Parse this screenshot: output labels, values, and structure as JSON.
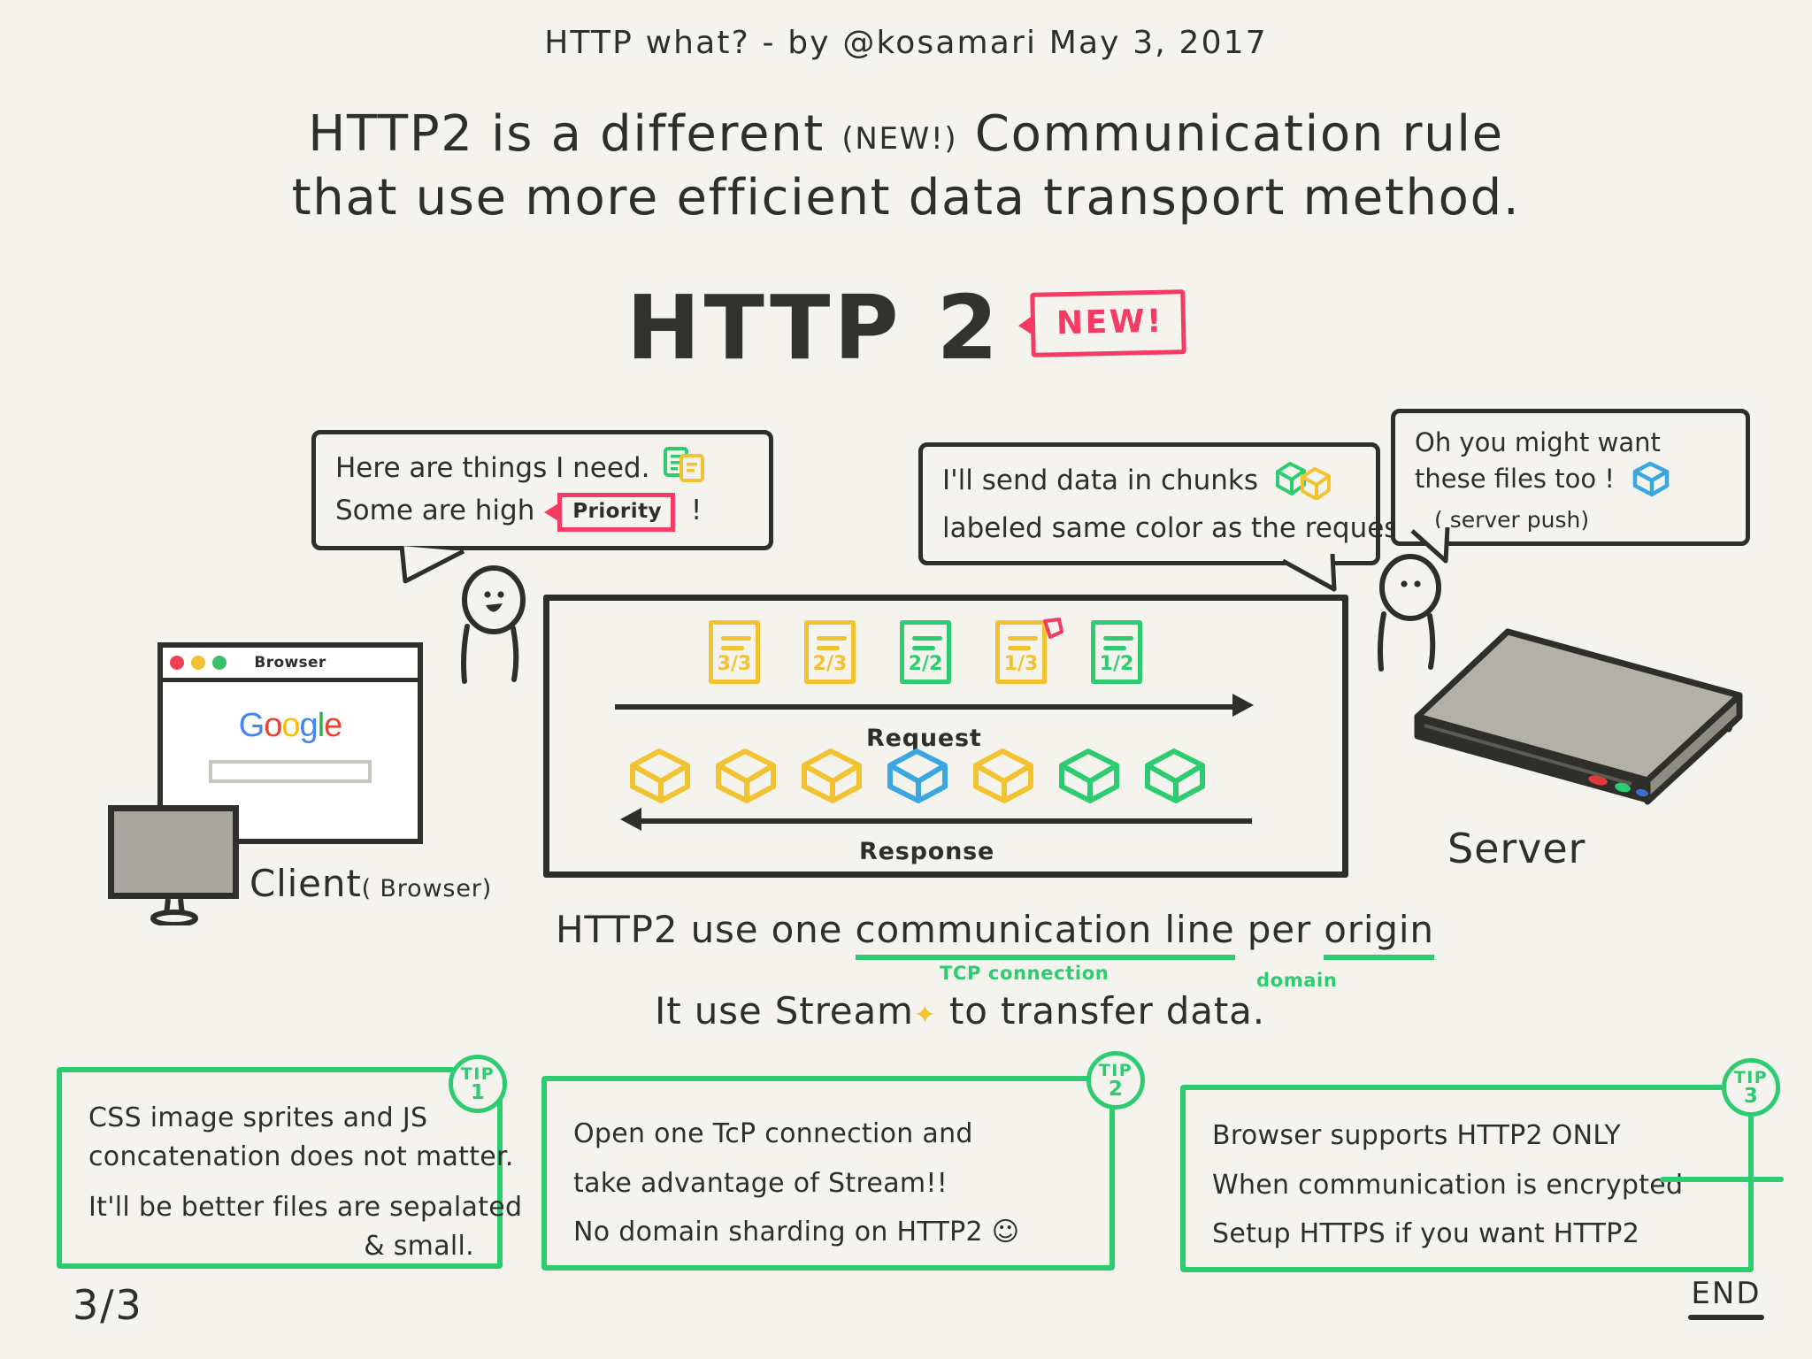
{
  "header": {
    "byline": "HTTP what? - by @kosamari   May 3, 2017",
    "headline_line1_a": "HTTP2 is a different",
    "headline_new": "(NEW!)",
    "headline_line1_b": "Communication rule",
    "headline_line2": "that use  more efficient data transport method.",
    "big_title": "HTTP 2",
    "new_badge": "NEW!"
  },
  "bubbles": {
    "client": {
      "line1": "Here are things I need.",
      "line2_before": "Some are high",
      "priority_tag": "Priority",
      "line2_after": "!"
    },
    "server_chunks": {
      "line1": "I'll send data in chunks",
      "line2": "labeled same color as the request."
    },
    "server_push": {
      "line1": "Oh you might want",
      "line2": "these files too !",
      "line3": "( server push)"
    }
  },
  "client": {
    "browser_title": "Browser",
    "logo": "Google",
    "logo_letters": [
      {
        "char": "G",
        "color": "#4285f4"
      },
      {
        "char": "o",
        "color": "#ea4335"
      },
      {
        "char": "o",
        "color": "#fbbc05"
      },
      {
        "char": "g",
        "color": "#4285f4"
      },
      {
        "char": "l",
        "color": "#34a853"
      },
      {
        "char": "e",
        "color": "#ea4335"
      }
    ],
    "dots": [
      "#ef4056",
      "#f2c231",
      "#39c16c"
    ],
    "label": "Client",
    "label_paren": "( Browser)"
  },
  "server": {
    "label": "Server"
  },
  "diagram": {
    "request_label": "Request",
    "response_label": "Response",
    "request_docs": [
      {
        "fraction": "3/3",
        "color": "#f2c231",
        "priority": false
      },
      {
        "fraction": "2/3",
        "color": "#f2c231",
        "priority": false
      },
      {
        "fraction": "2/2",
        "color": "#2ecc71",
        "priority": false
      },
      {
        "fraction": "1/3",
        "color": "#f2c231",
        "priority": true
      },
      {
        "fraction": "1/2",
        "color": "#2ecc71",
        "priority": false
      }
    ],
    "response_cubes": [
      {
        "color": "#f2c231"
      },
      {
        "color": "#f2c231"
      },
      {
        "color": "#f2c231"
      },
      {
        "color": "#3ba7e0"
      },
      {
        "color": "#f2c231"
      },
      {
        "color": "#2ecc71"
      },
      {
        "color": "#2ecc71"
      }
    ]
  },
  "captions": {
    "line1_a": "HTTP2 use  one ",
    "line1_underlined1": "communication line",
    "line1_b": " per ",
    "line1_underlined2": "origin",
    "annot_tcp": "TCP connection",
    "annot_domain": "domain",
    "line2_a": "It use  Stream",
    "line2_spark": "✦",
    "line2_b": " to transfer data."
  },
  "tips": [
    {
      "badge_label": "TIP",
      "badge_number": "1",
      "lines": [
        {
          "text": "CSS image sprites and JS",
          "align": "left"
        },
        {
          "text": "concatenation does not matter.",
          "align": "left"
        },
        {
          "text": "It'll be better files are sepalated",
          "align": "left"
        },
        {
          "text": "& small.",
          "align": "right"
        }
      ]
    },
    {
      "badge_label": "TIP",
      "badge_number": "2",
      "lines": [
        {
          "text": "Open  one TcP connection and",
          "align": "left"
        },
        {
          "text": "take advantage of  Stream!!",
          "align": "left"
        },
        {
          "text": "No domain sharding on HTTP2 ☺",
          "align": "left"
        }
      ]
    },
    {
      "badge_label": "TIP",
      "badge_number": "3",
      "lines": [
        {
          "text": "Browser  supports HTTP2 ONLY",
          "align": "left"
        },
        {
          "text": "When communication is encrypted",
          "align": "left",
          "underline_last": "encrypted"
        },
        {
          "text": "Setup HTTPS if you want HTTP2",
          "align": "left"
        }
      ]
    }
  ],
  "footer": {
    "page_number": "3/3",
    "end": "END"
  },
  "colors": {
    "ink": "#2e2e2b",
    "paper": "#f4f3ee",
    "green": "#2ecc71",
    "yellow": "#f2c231",
    "pink": "#f53b64",
    "blue": "#3ba7e0"
  }
}
